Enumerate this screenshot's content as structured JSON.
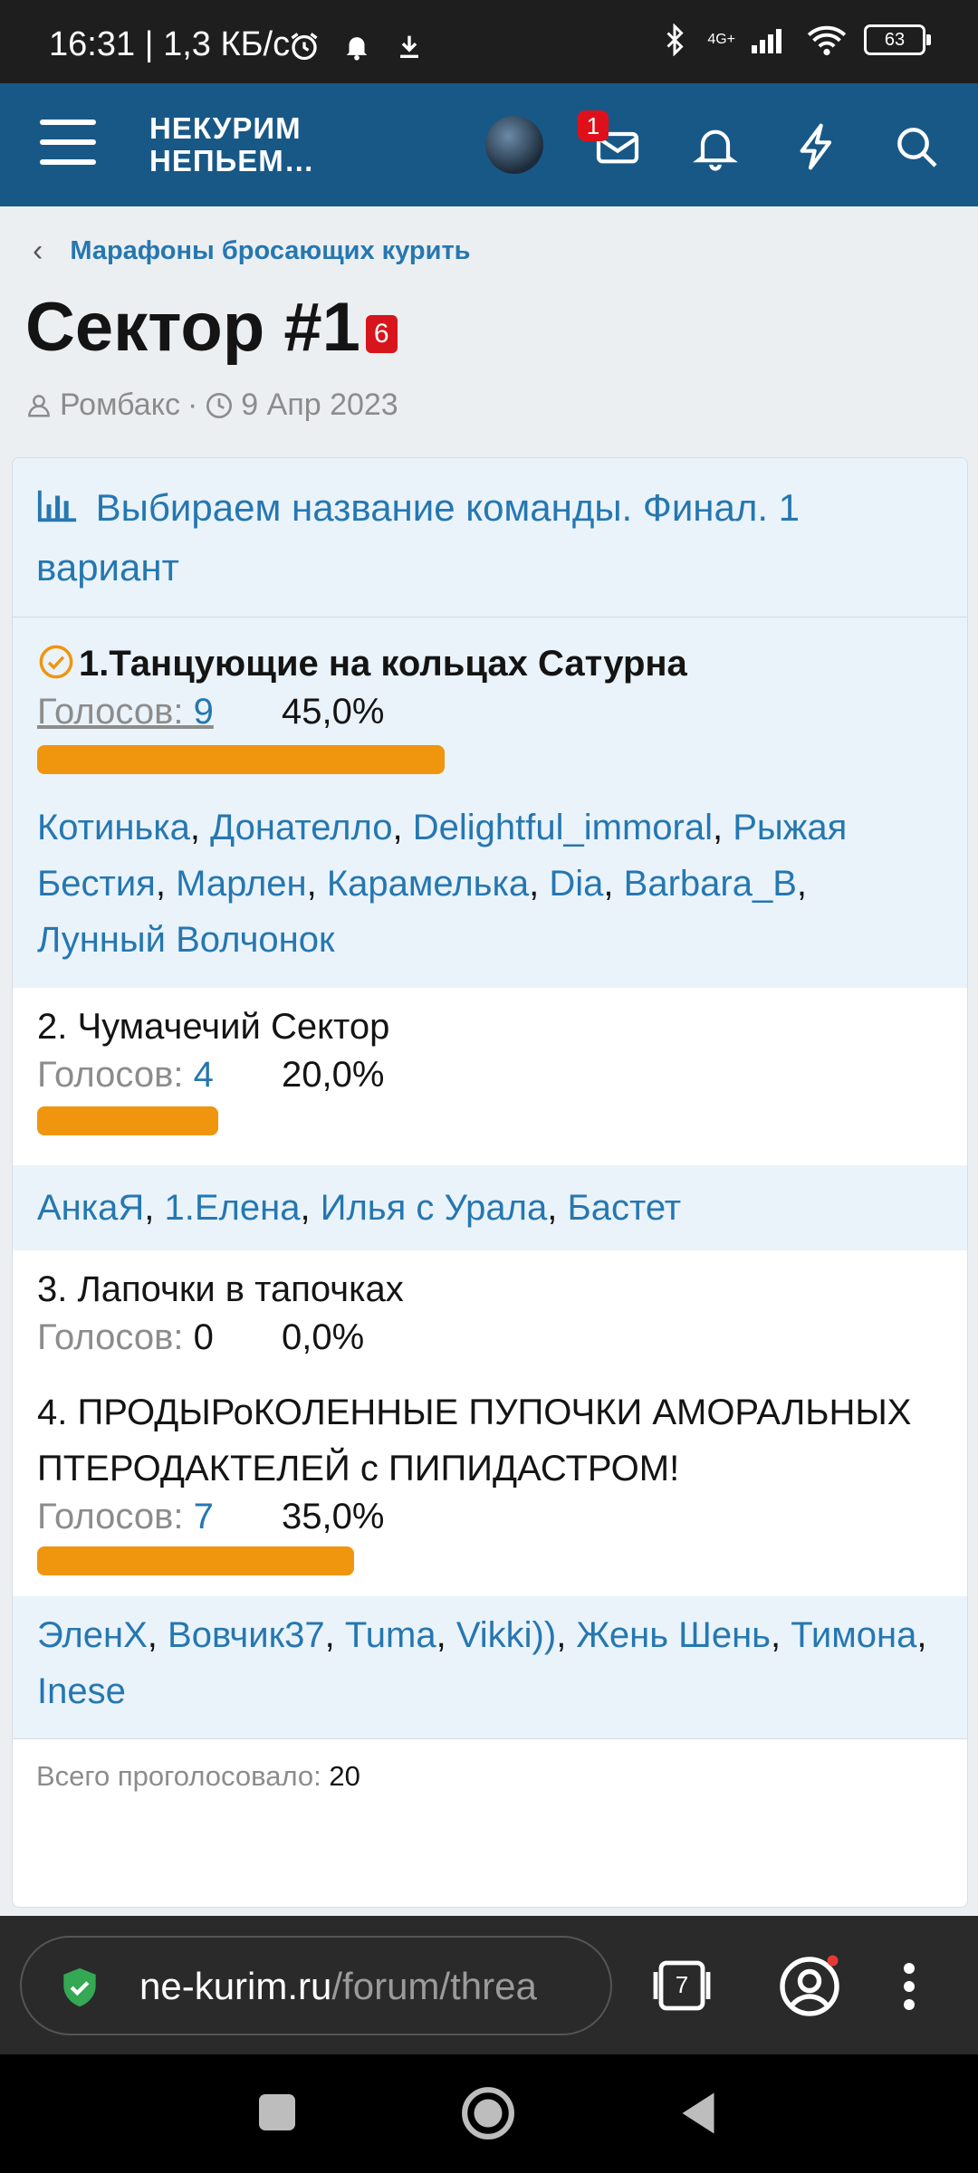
{
  "status": {
    "time": "16:31",
    "speed": "1,3 КБ/с",
    "net": "4G+",
    "battery": "63"
  },
  "header": {
    "logo_line1": "НЕКУРИМ",
    "logo_line2": "НЕПЬЕМ…",
    "inbox_badge": "1"
  },
  "breadcrumb": "Марафоны бросающих курить",
  "thread": {
    "title": "Сектор #1",
    "title_badge": "6",
    "author": "Ромбакс",
    "date": "9 Апр 2023"
  },
  "poll": {
    "question": "Выбираем название команды. Финал. 1 вариант",
    "votes_label": "Голосов: ",
    "options": [
      {
        "title": "1.Танцующие на кольцах Сатурна",
        "votes": "9",
        "percent": "45,0%",
        "fraction": 0.45,
        "voters": [
          "Котинька",
          "Донателло",
          "Delightful_immoral",
          "Рыжая Бестия",
          "Марлен",
          "Карамелька",
          "Dia",
          "Barbara_B",
          "Лунный Волчонок"
        ]
      },
      {
        "title": "2. Чумачечий Сектор",
        "votes": "4",
        "percent": "20,0%",
        "fraction": 0.2,
        "voters": [
          "АнкаЯ",
          "1.Елена",
          "Илья с Урала",
          "Бастет"
        ]
      },
      {
        "title": "3. Лапочки в тапочках",
        "votes": "0",
        "percent": "0,0%",
        "fraction": 0
      },
      {
        "title": "4. ПРОДЫРоКОЛЕННЫЕ ПУПОЧКИ АМОРАЛЬНЫХ ПТЕРОДАКТЕЛЕЙ с ПИПИДАСТРОМ!",
        "votes": "7",
        "percent": "35,0%",
        "fraction": 0.35,
        "voters": [
          "ЭленХ",
          "Вовчик37",
          "Tuma",
          "Vikki))",
          "Жень Шень",
          "Тимона",
          "Inese"
        ]
      }
    ],
    "total_label": "Всего проголосовало: ",
    "total": "20"
  },
  "browser": {
    "url_host": "ne-kurim.ru",
    "url_path": "/forum/threa",
    "tabs_count": "7"
  },
  "colors": {
    "header_bg": "#185886",
    "link": "#2577b1",
    "bar": "#f0950e",
    "badge": "#e0101b"
  }
}
